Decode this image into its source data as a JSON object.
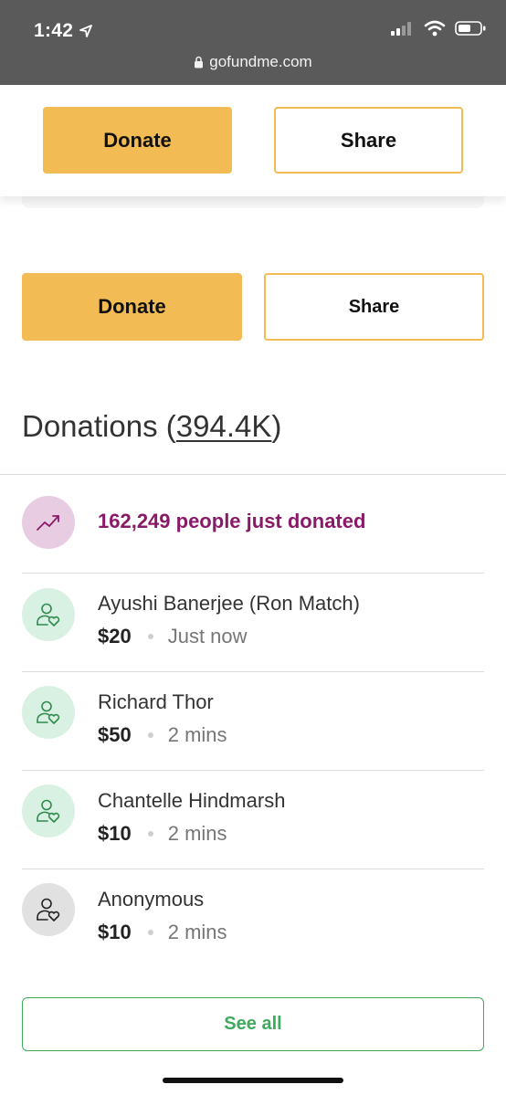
{
  "status_bar": {
    "time": "1:42",
    "url": "gofundme.com"
  },
  "sticky_bar": {
    "donate_label": "Donate",
    "share_label": "Share"
  },
  "actions": {
    "donate_label": "Donate",
    "share_label": "Share"
  },
  "donations": {
    "title": "Donations",
    "open_paren": "(",
    "count": "394.4K",
    "close_paren": ")"
  },
  "trend": {
    "text": "162,249 people just donated",
    "icon": "trending-up-icon"
  },
  "donors": [
    {
      "name": "Ayushi Banerjee (Ron Match)",
      "amount": "$20",
      "time": "Just now",
      "avatar": "donor-heart-icon"
    },
    {
      "name": "Richard Thor",
      "amount": "$50",
      "time": "2 mins",
      "avatar": "donor-heart-icon"
    },
    {
      "name": "Chantelle Hindmarsh",
      "amount": "$10",
      "time": "2 mins",
      "avatar": "donor-heart-icon"
    },
    {
      "name": "Anonymous",
      "amount": "$10",
      "time": "2 mins",
      "avatar": "anonymous-donor-icon"
    }
  ],
  "see_all_label": "See all",
  "colors": {
    "donate_yellow": "#f2bb53",
    "trend_purple": "#8a1a68",
    "trend_avatar_bg": "#e8cde2",
    "donor_avatar_bg": "#d9f1e2",
    "anon_avatar_bg": "#e1e1e1",
    "green": "#3eaa5c"
  }
}
